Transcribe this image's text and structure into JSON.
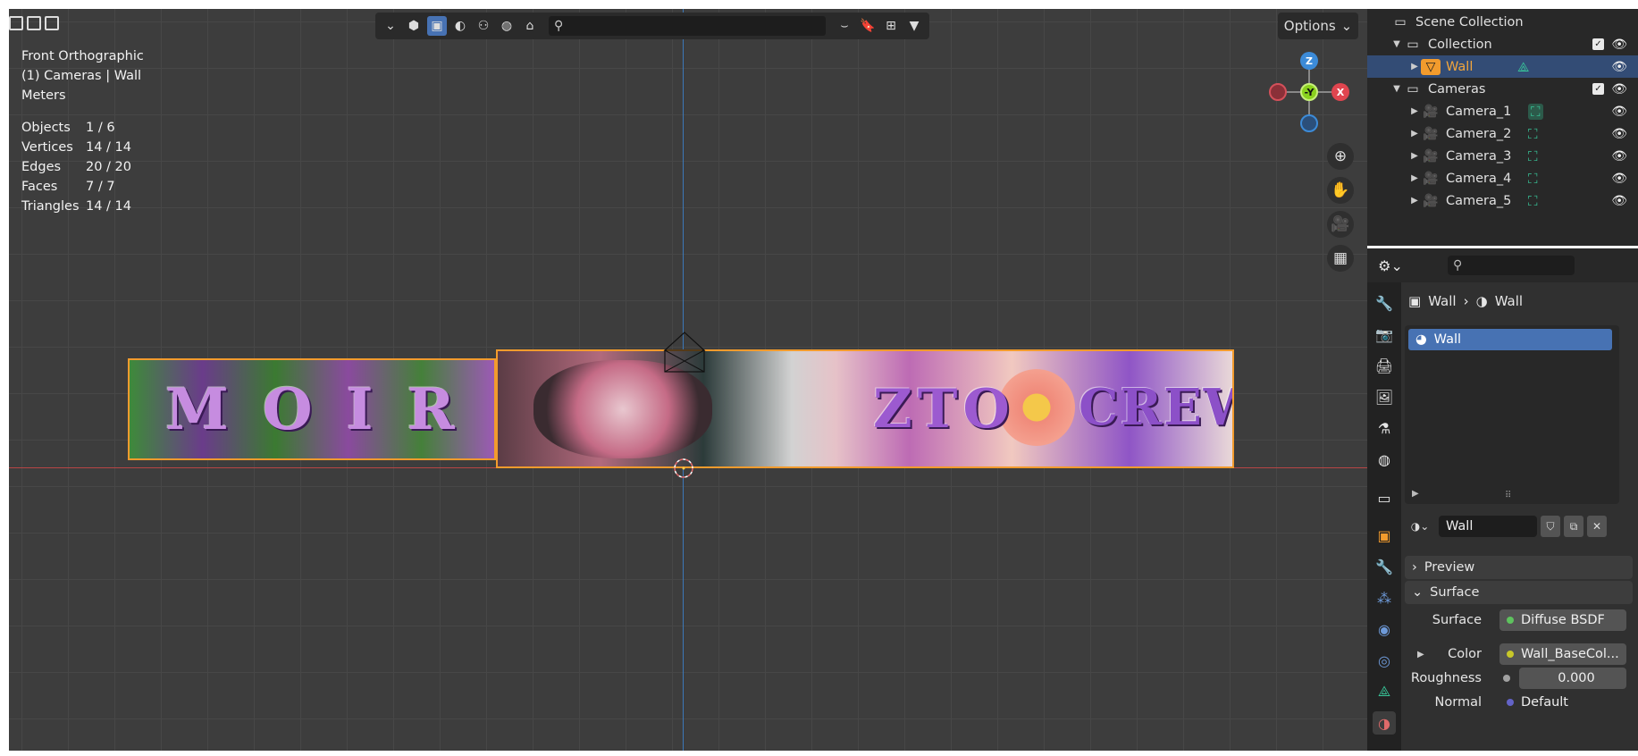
{
  "viewport": {
    "view_name": "Front Orthographic",
    "collection_object": "(1) Cameras | Wall",
    "units": "Meters",
    "stats": [
      {
        "label": "Objects",
        "value": "1 / 6"
      },
      {
        "label": "Vertices",
        "value": "14 / 14"
      },
      {
        "label": "Edges",
        "value": "20 / 20"
      },
      {
        "label": "Faces",
        "value": "7 / 7"
      },
      {
        "label": "Triangles",
        "value": "14 / 14"
      }
    ],
    "options_label": "Options",
    "gizmo": {
      "z": "Z",
      "y": "-Y",
      "x": "X"
    },
    "graffiti_left": "MOIR",
    "graffiti_right_a": "ZTO",
    "graffiti_right_b": "CREW"
  },
  "outliner": {
    "scene_collection": "Scene Collection",
    "items": [
      {
        "label": "Collection"
      },
      {
        "label": "Wall"
      },
      {
        "label": "Cameras"
      },
      {
        "label": "Camera_1"
      },
      {
        "label": "Camera_2"
      },
      {
        "label": "Camera_3"
      },
      {
        "label": "Camera_4"
      },
      {
        "label": "Camera_5"
      }
    ]
  },
  "properties": {
    "breadcrumb_object": "Wall",
    "breadcrumb_material": "Wall",
    "slot_material": "Wall",
    "material_name": "Wall",
    "preview_label": "Preview",
    "surface_panel_label": "Surface",
    "rows": {
      "surface_label": "Surface",
      "surface_value": "Diffuse BSDF",
      "color_label": "Color",
      "color_value": "Wall_BaseCol...",
      "roughness_label": "Roughness",
      "roughness_value": "0.000",
      "normal_label": "Normal",
      "normal_value": "Default"
    }
  },
  "colors": {
    "selection_orange": "#f29b2d",
    "active_blue": "#4772b3",
    "axis_x": "#e0454f",
    "axis_y": "#8ad11e",
    "axis_z": "#3c8bd8"
  }
}
